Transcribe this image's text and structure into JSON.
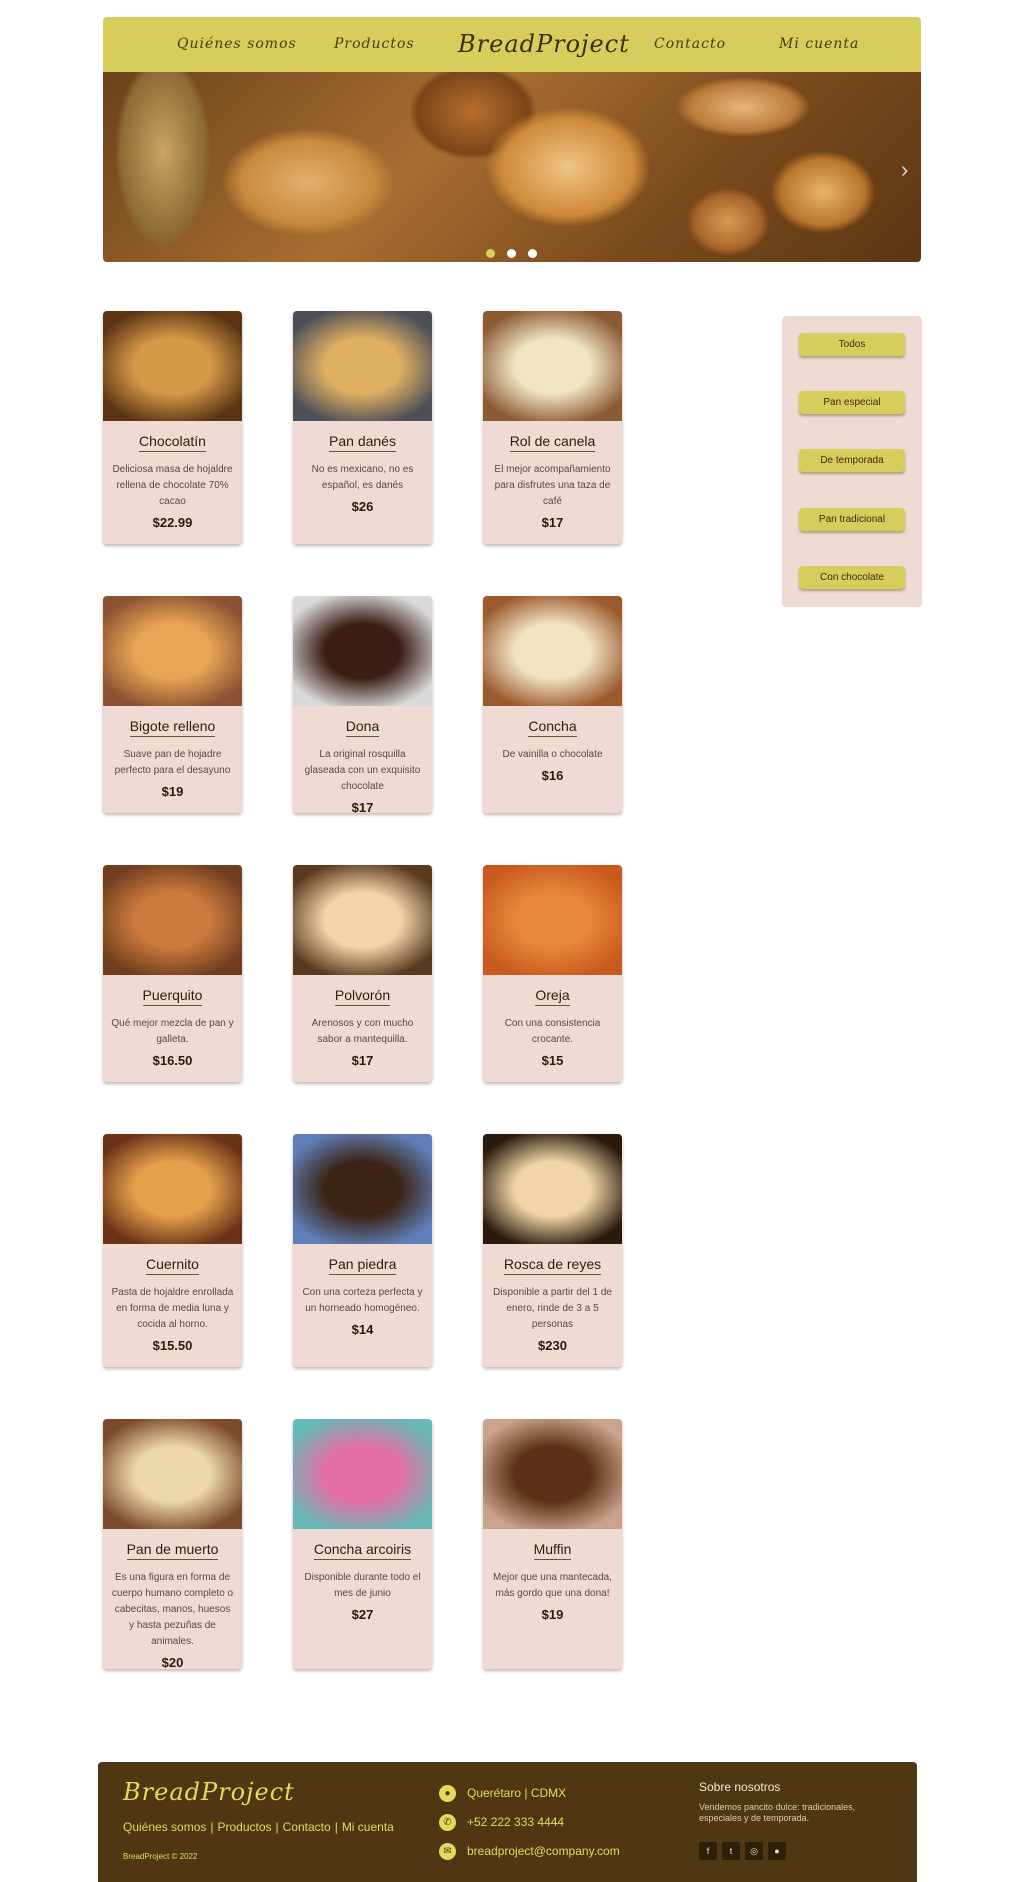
{
  "nav": {
    "about": "Quiénes somos",
    "products": "Productos",
    "brand": "BreadProject",
    "contact": "Contacto",
    "account": "Mi cuenta"
  },
  "hero": {
    "slides": 3,
    "active_slide": 1,
    "next_arrow": "›"
  },
  "products": [
    {
      "name": "Chocolatín",
      "desc": "Deliciosa masa de hojaldre rellena de chocolate 70% cacao",
      "price": "$22.99",
      "img_colors": [
        "#d79a48",
        "#5a3414"
      ]
    },
    {
      "name": "Pan danés",
      "desc": "No es mexicano, no es español, es danés",
      "price": "$26",
      "img_colors": [
        "#e0b062",
        "#4c4f58"
      ]
    },
    {
      "name": "Rol de canela",
      "desc": "El mejor acompañamiento para disfrutes una taza de café",
      "price": "$17",
      "img_colors": [
        "#f2e4c6",
        "#8a5a32"
      ]
    },
    {
      "name": "Bigote relleno",
      "desc": "Suave pan de hojadre perfecto para el desayuno",
      "price": "$19",
      "img_colors": [
        "#e9a455",
        "#8a5232"
      ]
    },
    {
      "name": "Dona",
      "desc": "La original rosquilla glaseada con un exquisito chocolate",
      "price": "$17",
      "img_colors": [
        "#3b1d14",
        "#d9d9d9"
      ]
    },
    {
      "name": "Concha",
      "desc": "De vainilla o chocolate",
      "price": "$16",
      "img_colors": [
        "#f3e2c4",
        "#9b5a2c"
      ]
    },
    {
      "name": "Puerquito",
      "desc": "Qué mejor mezcla de pan y galleta.",
      "price": "$16.50",
      "img_colors": [
        "#cc7a3e",
        "#6e3e1e"
      ]
    },
    {
      "name": "Polvorón",
      "desc": "Arenosos y con mucho sabor a mantequilla.",
      "price": "$17",
      "img_colors": [
        "#f1d7a8",
        "#5a3a1e"
      ]
    },
    {
      "name": "Oreja",
      "desc": "Con una consistencia crocante.",
      "price": "$15",
      "img_colors": [
        "#e8863a",
        "#c75a1c"
      ]
    },
    {
      "name": "Cuernito",
      "desc": "Pasta de hojaldre enrollada en forma de media luna y cocida al horno.",
      "price": "$15.50",
      "img_colors": [
        "#e5a04c",
        "#6a3318"
      ]
    },
    {
      "name": "Pan piedra",
      "desc": "Con una corteza perfecta y un horneado homogéneo.",
      "price": "$14",
      "img_colors": [
        "#3b2414",
        "#5f7fb8"
      ]
    },
    {
      "name": "Rosca de reyes",
      "desc": "Disponible a partir del 1 de enero, rinde de 3 a 5 personas",
      "price": "$230",
      "img_colors": [
        "#f0d6a6",
        "#2a1a0e"
      ]
    },
    {
      "name": "Pan de muerto",
      "desc": "Es una figura en forma de cuerpo humano completo o cabecitas, manos, huesos y hasta pezuñas de animales.",
      "price": "$20",
      "img_colors": [
        "#edd8a8",
        "#7a4a2a"
      ]
    },
    {
      "name": "Concha arcoiris",
      "desc": "Disponible durante todo el mes de junio",
      "price": "$27",
      "img_colors": [
        "#e46fa2",
        "#68b8b6"
      ]
    },
    {
      "name": "Muffin",
      "desc": "Mejor que una mantecada, más gordo que una dona!",
      "price": "$19",
      "img_colors": [
        "#5c3018",
        "#c9a48a"
      ]
    }
  ],
  "filters": [
    "Todos",
    "Pan especial",
    "De temporada",
    "Pan tradicional",
    "Con chocolate"
  ],
  "footer": {
    "brand": "BreadProject",
    "links": [
      "Quiénes somos",
      "Productos",
      "Contacto",
      "Mi cuenta"
    ],
    "separator": "|",
    "copyright": "BreadProject © 2022",
    "location": "Querétaro | CDMX",
    "phone": "+52 222 333 4444",
    "email": "breadproject@company.com",
    "about_title": "Sobre nosotros",
    "about_text": "Vendemos pancito dulce: tradicionales, especiales y de temporada.",
    "social_icons": [
      "facebook-icon",
      "twitter-icon",
      "instagram-icon",
      "github-icon"
    ],
    "social_glyphs": [
      "f",
      "t",
      "◎",
      "●"
    ],
    "contact_icons": [
      "location-icon",
      "phone-icon",
      "mail-icon"
    ],
    "contact_glyphs": [
      "●",
      "✆",
      "✉"
    ]
  },
  "colors": {
    "accent": "#d6cd5c",
    "card_bg": "#efdad4",
    "footer_bg": "#4f3713",
    "footer_text": "#e6da5e"
  }
}
